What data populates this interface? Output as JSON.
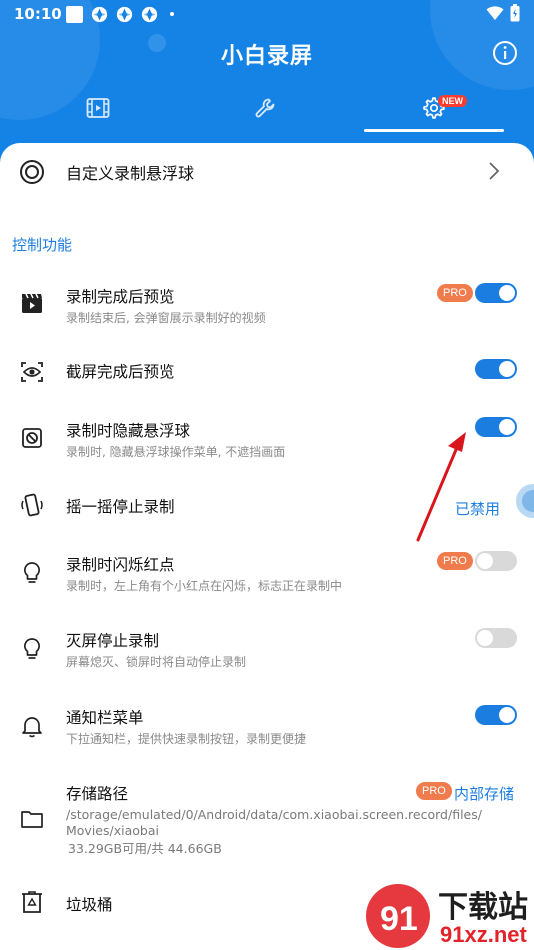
{
  "status_bar": {
    "time": "10:10"
  },
  "app": {
    "title": "小白录屏",
    "tab_badge": "NEW"
  },
  "colors": {
    "primary": "#1583e6",
    "accent_blue": "#1f7fe0",
    "pro_badge": "#f07c4e",
    "toggle_on": "#1b7de0",
    "toggle_off": "#d9d9d9",
    "arrow": "#d8161c"
  },
  "tabs": [
    {
      "icon": "video-file-icon"
    },
    {
      "icon": "wrench-icon"
    },
    {
      "icon": "gear-icon",
      "selected": true
    }
  ],
  "top_item": {
    "label": "自定义录制悬浮球",
    "icon": "target-icon"
  },
  "section": {
    "title": "控制功能"
  },
  "settings": {
    "preview_after_record": {
      "title": "录制完成后预览",
      "subtitle": "录制结束后, 会弹窗展示录制好的视频",
      "pro": "PRO",
      "enabled": true
    },
    "preview_after_screenshot": {
      "title": "截屏完成后预览",
      "enabled": true
    },
    "hide_ball_while_recording": {
      "title": "录制时隐藏悬浮球",
      "subtitle": "录制时, 隐藏悬浮球操作菜单, 不遮挡画面",
      "enabled": true
    },
    "shake_to_stop": {
      "title": "摇一摇停止录制",
      "value": "已禁用"
    },
    "flash_red_dot": {
      "title": "录制时闪烁红点",
      "subtitle": "录制时，左上角有个小红点在闪烁，标志正在录制中",
      "pro": "PRO",
      "enabled": false
    },
    "screen_off_stop": {
      "title": "灭屏停止录制",
      "subtitle": "屏幕熄灭、锁屏时将自动停止录制",
      "enabled": false
    },
    "notification_menu": {
      "title": "通知栏菜单",
      "subtitle": "下拉通知栏，提供快速录制按钮，录制更便捷",
      "enabled": true
    },
    "storage_path": {
      "title": "存储路径",
      "pro": "PRO",
      "value": "内部存储",
      "path_line1": "/storage/emulated/0/Android/data/com.xiaobai.screen.record/files/",
      "path_line2": "Movies/xiaobai",
      "space": "33.29GB可用/共 44.66GB"
    },
    "trash": {
      "title": "垃圾桶"
    }
  },
  "watermark": {
    "brand": "下载站",
    "domain": "91xz.net"
  }
}
